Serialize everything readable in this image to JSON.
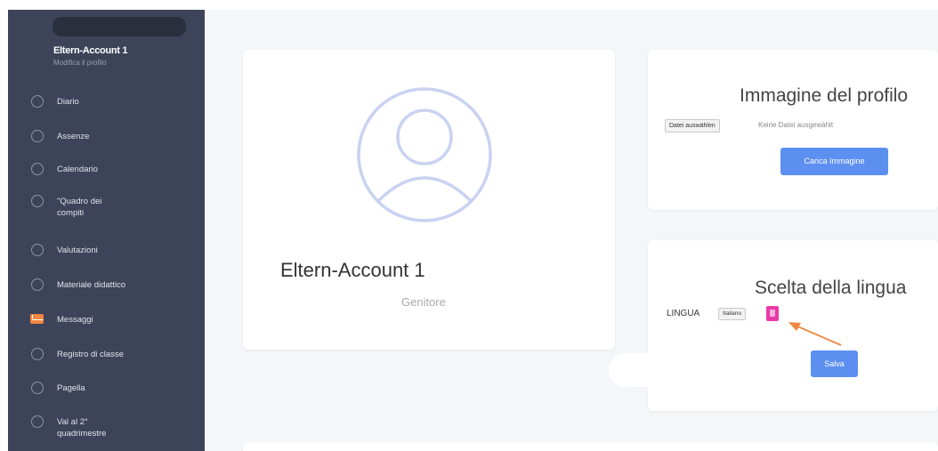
{
  "sidebar": {
    "user_name": "Eltern-Account 1",
    "user_sub": "Modifica il profilo",
    "items": [
      {
        "label": "Diario",
        "icon": "circle-icon"
      },
      {
        "label": "Assenze",
        "icon": "circle-icon"
      },
      {
        "label": "Calendario",
        "icon": "circle-icon"
      },
      {
        "label": "\"Quadro dei compiti",
        "icon": "circle-icon"
      },
      {
        "label": "Valutazioni",
        "icon": "circle-icon"
      },
      {
        "label": "Materiale didattico",
        "icon": "circle-icon"
      },
      {
        "label": "Messaggi",
        "icon": "envelope-icon",
        "active": true
      },
      {
        "label": "Registro di classe",
        "icon": "circle-icon"
      },
      {
        "label": "Pagella",
        "icon": "circle-icon"
      },
      {
        "label": "Val al 2° quadrimestre",
        "icon": "circle-icon"
      }
    ]
  },
  "profile": {
    "name": "Eltern-Account 1",
    "role": "Genitore"
  },
  "image_section": {
    "title": "Immagine del profilo",
    "file_button": "Datei auswählen",
    "file_status": "Keine Datei ausgewählt",
    "upload_button": "Carica Immagine"
  },
  "language_section": {
    "title": "Scelta della lingua",
    "label": "LINGUA",
    "selected": "Italiano",
    "save_button": "Salva"
  },
  "colors": {
    "sidebar_bg": "#3d4459",
    "accent_button": "#5c8ff0",
    "arrow": "#f0863f",
    "message_icon": "#f0863f",
    "flag": "#e83aa8"
  }
}
